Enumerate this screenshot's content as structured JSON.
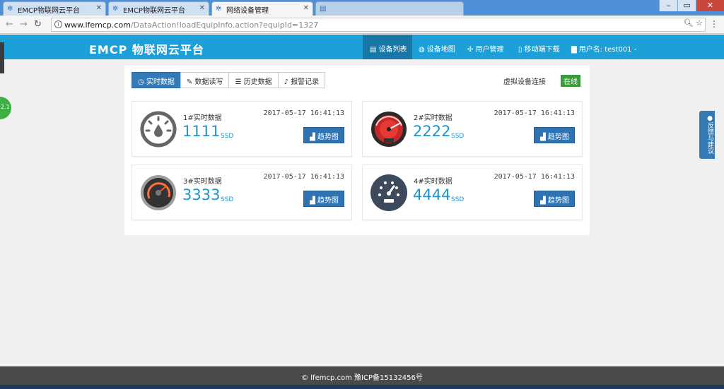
{
  "browser": {
    "tabs": [
      {
        "label": "EMCP物联网云平台"
      },
      {
        "label": "EMCP物联网云平台"
      },
      {
        "label": "网络设备管理"
      }
    ],
    "url": "www.lfemcp.com",
    "url_rest": "/DataAction!loadEquipInfo.action?equipId=1327"
  },
  "header": {
    "logo": "EMCP 物联网云平台",
    "nav": [
      {
        "label": "设备列表",
        "icon": "list-icon"
      },
      {
        "label": "设备地图",
        "icon": "globe-icon"
      },
      {
        "label": "用户管理",
        "icon": "users-icon"
      },
      {
        "label": "移动端下载",
        "icon": "mobile-icon"
      },
      {
        "label": "用户名: test001 -",
        "icon": "user-icon"
      }
    ]
  },
  "panel": {
    "tabs": [
      "实时数据",
      "数据读写",
      "历史数据",
      "报警记录"
    ],
    "connection_label": "虚拟设备连接",
    "status": "在线",
    "cards": [
      {
        "name": "1#实时数据",
        "time": "2017-05-17 16:41:13",
        "value": "1111",
        "unit": "SSD",
        "button": "趋势图"
      },
      {
        "name": "2#实时数据",
        "time": "2017-05-17 16:41:13",
        "value": "2222",
        "unit": "SSD",
        "button": "趋势图"
      },
      {
        "name": "3#实时数据",
        "time": "2017-05-17 16:41:13",
        "value": "3333",
        "unit": "SSD",
        "button": "趋势图"
      },
      {
        "name": "4#实时数据",
        "time": "2017-05-17 16:41:13",
        "value": "4444",
        "unit": "SSD",
        "button": "趋势图"
      }
    ]
  },
  "side": {
    "feedback": "反馈与建议",
    "badge": "2.1"
  },
  "footer": {
    "text": "lfemcp.com 豫ICP备15132456号"
  },
  "colors": {
    "accent": "#1da0d8",
    "primary": "#337ab7",
    "online": "#3a9a3a",
    "value": "#1d96cf"
  }
}
